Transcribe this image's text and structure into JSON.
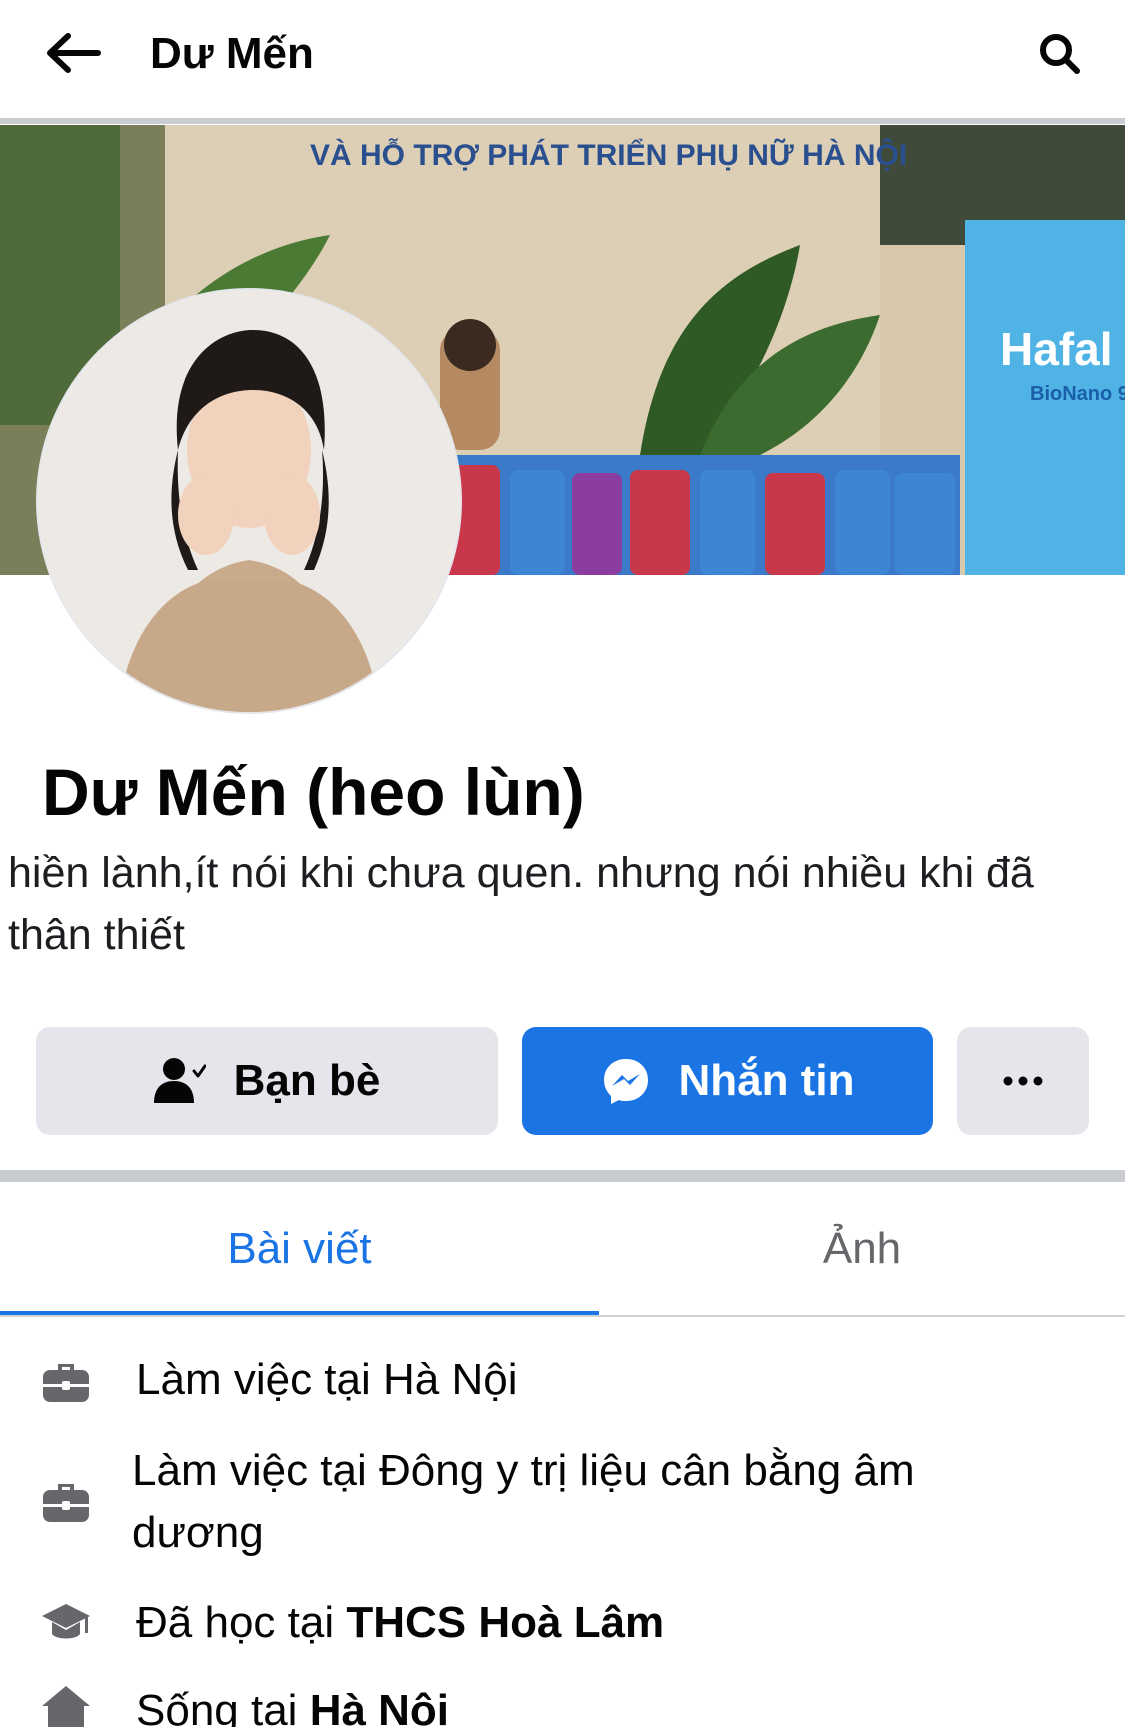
{
  "header": {
    "title": "Dư Mến",
    "back_icon": "arrow-left-icon",
    "search_icon": "search-icon"
  },
  "cover": {
    "banner_text": "VÀ HỖ TRỢ PHÁT TRIỂN PHỤ NỮ HÀ NỘI",
    "product_text": "Hafal",
    "product_sub": "BioNano 9"
  },
  "profile": {
    "name": "Dư Mến (heo lùn)",
    "bio": "hiền lành,ít nói khi chưa quen. nhưng nói nhiều khi đã thân thiết"
  },
  "actions": {
    "friends_label": "Bạn bè",
    "message_label": "Nhắn tin",
    "more_label": "···"
  },
  "tabs": [
    {
      "label": "Bài viết",
      "active": true
    },
    {
      "label": "Ảnh",
      "active": false
    }
  ],
  "about": [
    {
      "icon": "briefcase-icon",
      "prefix": "Làm việc tại Hà Nội",
      "bold": ""
    },
    {
      "icon": "briefcase-icon",
      "prefix": "Làm việc tại Đông y trị liệu cân bằng âm dương",
      "bold": ""
    },
    {
      "icon": "graduation-cap-icon",
      "prefix": "Đã học tại ",
      "bold": "THCS Hoà Lâm"
    },
    {
      "icon": "home-icon",
      "prefix": "Sống tại ",
      "bold": "Hà Nội"
    }
  ],
  "colors": {
    "accent": "#1b74e4",
    "button_gray": "#e4e6eb",
    "divider": "#c9ccd1",
    "secondary_text": "#65676b"
  }
}
